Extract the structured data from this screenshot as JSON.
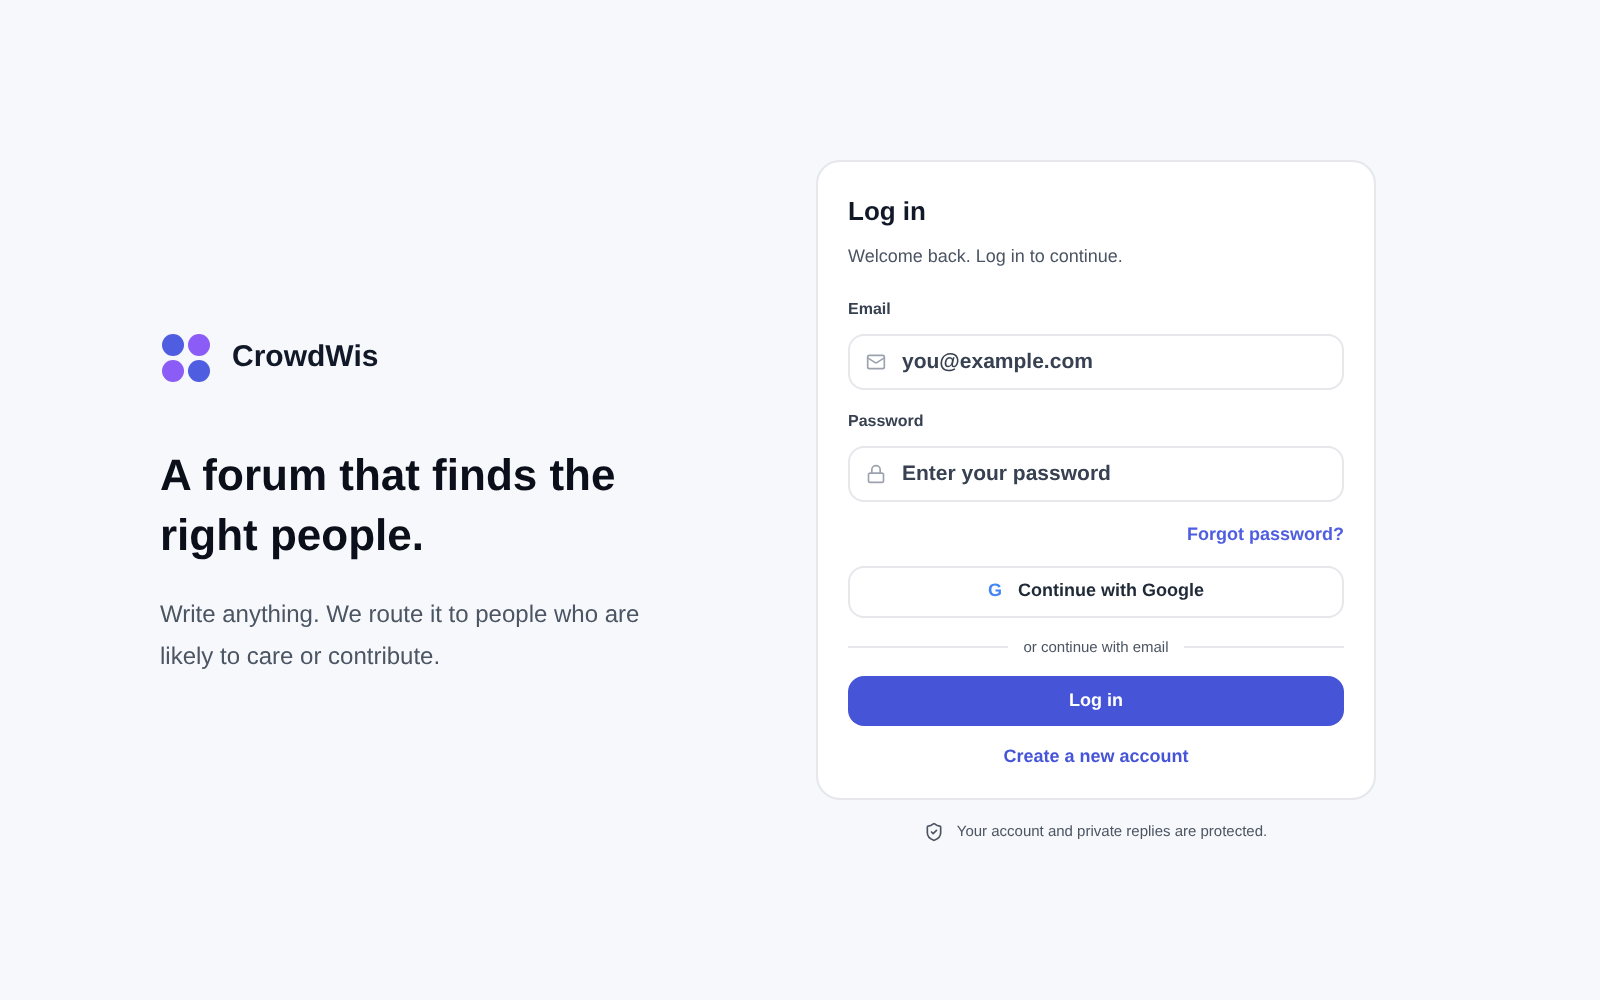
{
  "brand": {
    "name": "CrowdWis"
  },
  "hero": {
    "headline": "A forum that finds the right people.",
    "subtext": "Write anything. We route it to people who are likely to care or contribute."
  },
  "login_card": {
    "title": "Log in",
    "subtitle": "Welcome back. Log in to continue.",
    "fields": [
      {
        "label": "Email",
        "placeholder": "you@example.com",
        "kind": "email"
      },
      {
        "label": "Password",
        "placeholder": "Enter your password",
        "kind": "password"
      }
    ],
    "forgot_link": "Forgot password?",
    "google_button": {
      "glyph": "G",
      "label": "Continue with Google"
    },
    "divider_text": "or continue with email",
    "submit_button": "Log in",
    "create_link": "Create a new account"
  },
  "footer_note": "Your account and private replies are protected."
}
